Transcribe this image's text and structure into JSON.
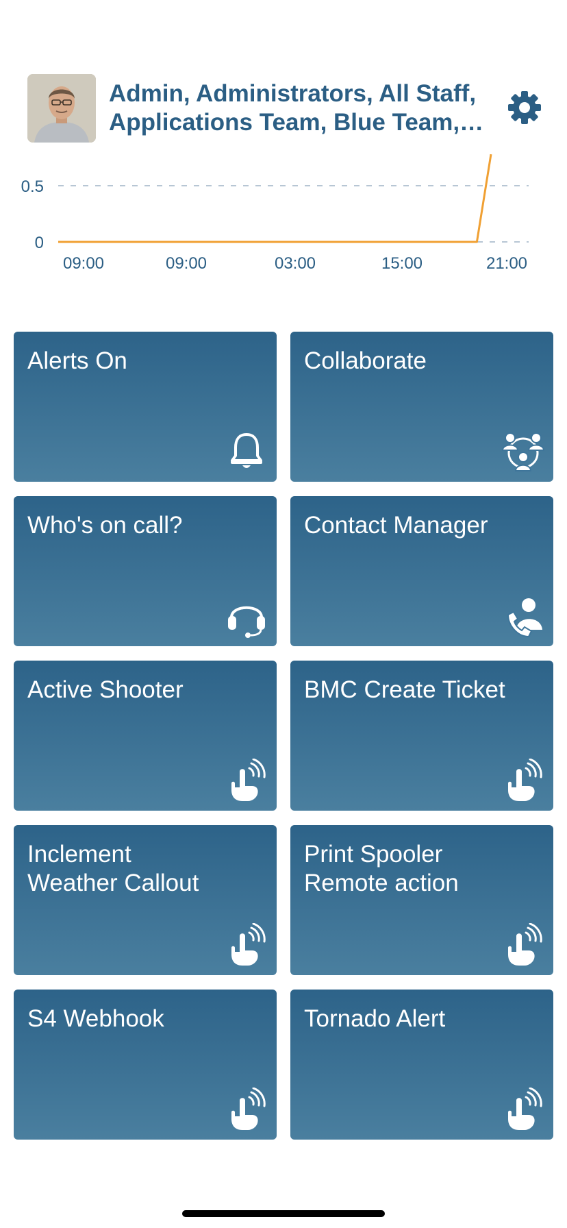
{
  "header": {
    "groups_text": "Admin, Administrators, All Staff, Applications Team, Blue Team, Carrier Team, Database Team",
    "avatar": "user-avatar-photo",
    "settings_icon": "gear-icon"
  },
  "chart_data": {
    "type": "line",
    "y_ticks": [
      "0.5",
      "0"
    ],
    "x_ticks": [
      "09:00",
      "09:00",
      "03:00",
      "15:00",
      "21:00"
    ],
    "ylim": [
      0,
      1
    ],
    "grid": "dashed horizontal",
    "series": [
      {
        "color": "#f0a033",
        "points": [
          [
            0,
            0
          ],
          [
            0.89,
            0
          ],
          [
            0.92,
            0.78
          ]
        ]
      }
    ]
  },
  "tiles": [
    {
      "label": "Alerts On",
      "icon": "bell-icon"
    },
    {
      "label": "Collaborate",
      "icon": "collaborate-icon"
    },
    {
      "label": "Who's on call?",
      "icon": "headset-icon"
    },
    {
      "label": "Contact Manager",
      "icon": "contact-phone-icon"
    },
    {
      "label": "Active Shooter",
      "icon": "tap-icon"
    },
    {
      "label": "BMC Create Ticket",
      "icon": "tap-icon"
    },
    {
      "label": "Inclement\nWeather Callout",
      "icon": "tap-icon"
    },
    {
      "label": "Print Spooler\nRemote action",
      "icon": "tap-icon"
    },
    {
      "label": "S4 Webhook",
      "icon": "tap-icon"
    },
    {
      "label": "Tornado Alert",
      "icon": "tap-icon"
    }
  ],
  "colors": {
    "primary": "#2b5e84",
    "tile_top": "#2d6389",
    "tile_bottom": "#4a7f9f",
    "line": "#f0a033"
  }
}
